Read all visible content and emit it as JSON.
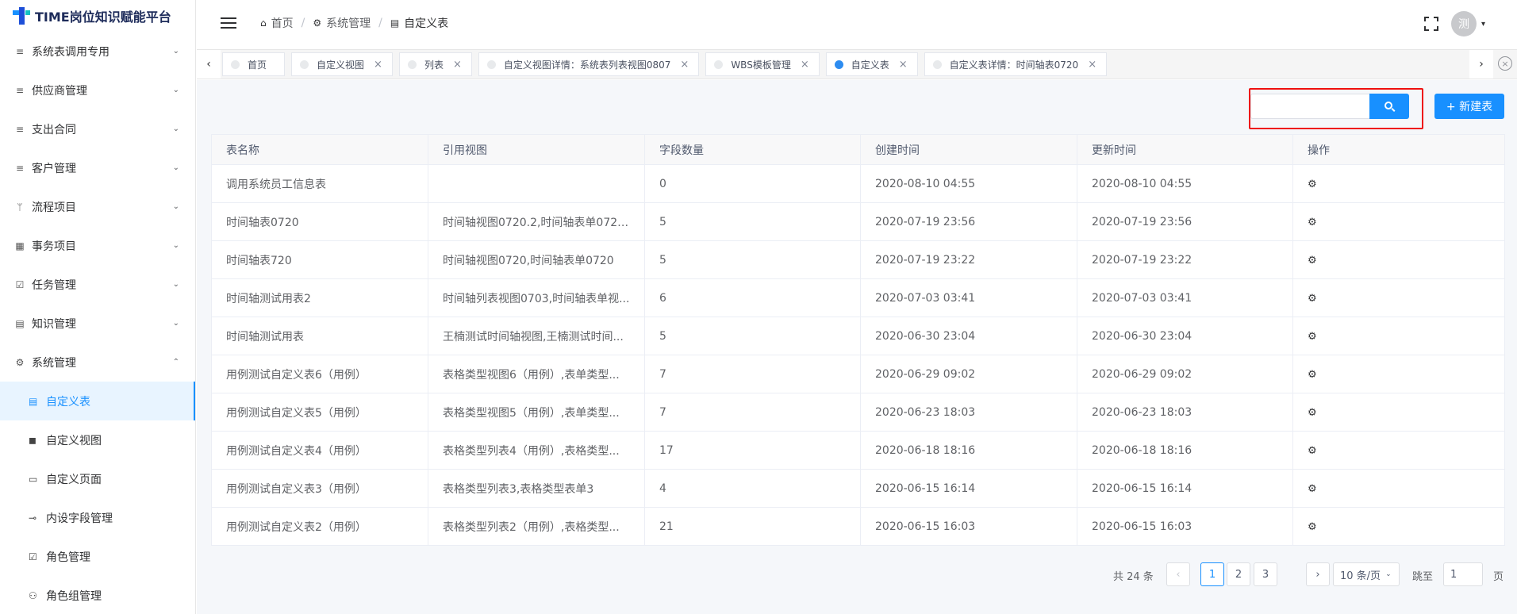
{
  "app": {
    "title": "TIME岗位知识赋能平台"
  },
  "sidebar": {
    "items": [
      {
        "label": "系统表调用专用",
        "icon": "list-icon",
        "glyph": "≡",
        "arrow": "⌄"
      },
      {
        "label": "供应商管理",
        "icon": "list-icon",
        "glyph": "≡",
        "arrow": "⌄"
      },
      {
        "label": "支出合同",
        "icon": "list-icon",
        "glyph": "≡",
        "arrow": "⌄"
      },
      {
        "label": "客户管理",
        "icon": "list-icon",
        "glyph": "≡",
        "arrow": "⌄"
      },
      {
        "label": "流程项目",
        "icon": "branch-icon",
        "glyph": "ᛘ",
        "arrow": "⌄"
      },
      {
        "label": "事务项目",
        "icon": "grid-icon",
        "glyph": "▦",
        "arrow": "⌄"
      },
      {
        "label": "任务管理",
        "icon": "calendar-check-icon",
        "glyph": "☑",
        "arrow": "⌄"
      },
      {
        "label": "知识管理",
        "icon": "book-icon",
        "glyph": "▤",
        "arrow": "⌄"
      },
      {
        "label": "系统管理",
        "icon": "gear-icon",
        "glyph": "⚙",
        "arrow": "⌃"
      }
    ],
    "subitems": [
      {
        "label": "自定义表",
        "icon": "document-icon",
        "glyph": "▤",
        "active": true
      },
      {
        "label": "自定义视图",
        "icon": "copy-icon",
        "glyph": "◼",
        "active": false
      },
      {
        "label": "自定义页面",
        "icon": "window-icon",
        "glyph": "▭",
        "active": false
      },
      {
        "label": "内设字段管理",
        "icon": "link-icon",
        "glyph": "⊸",
        "active": false
      },
      {
        "label": "角色管理",
        "icon": "checkbox-icon",
        "glyph": "☑",
        "active": false
      },
      {
        "label": "角色组管理",
        "icon": "people-icon",
        "glyph": "⚇",
        "active": false
      }
    ]
  },
  "header": {
    "breadcrumb": [
      {
        "label": "首页",
        "icon": "home-icon",
        "glyph": "⌂"
      },
      {
        "label": "系统管理",
        "icon": "gear-icon",
        "glyph": "⚙"
      },
      {
        "label": "自定义表",
        "icon": "document-icon",
        "glyph": "▤"
      }
    ],
    "separator": "/",
    "avatar_text": "测",
    "caret": "▾"
  },
  "tags": {
    "items": [
      {
        "label": "首页",
        "active": false,
        "closable": false
      },
      {
        "label": "自定义视图",
        "active": false,
        "closable": true
      },
      {
        "label": "列表",
        "active": false,
        "closable": true
      },
      {
        "label": "自定义视图详情：系统表列表视图0807",
        "active": false,
        "closable": true
      },
      {
        "label": "WBS模板管理",
        "active": false,
        "closable": true
      },
      {
        "label": "自定义表",
        "active": true,
        "closable": true
      },
      {
        "label": "自定义表详情：时间轴表0720",
        "active": false,
        "closable": true
      }
    ],
    "close_glyph": "×",
    "left_glyph": "‹",
    "right_glyph": "›",
    "close_all_glyph": "×"
  },
  "toolbar": {
    "search_value": "",
    "search_placeholder": "",
    "new_button": "+ 新建表"
  },
  "table": {
    "columns": [
      "表名称",
      "引用视图",
      "字段数量",
      "创建时间",
      "更新时间",
      "操作"
    ],
    "action_glyph": "⚙",
    "rows": [
      {
        "name": "调用系统员工信息表",
        "views": "",
        "count": "0",
        "created": "2020-08-10 04:55",
        "updated": "2020-08-10 04:55"
      },
      {
        "name": "时间轴表0720",
        "views": "时间轴视图0720.2,时间轴表单0720...",
        "count": "5",
        "created": "2020-07-19 23:56",
        "updated": "2020-07-19 23:56"
      },
      {
        "name": "时间轴表720",
        "views": "时间轴视图0720,时间轴表单0720",
        "count": "5",
        "created": "2020-07-19 23:22",
        "updated": "2020-07-19 23:22"
      },
      {
        "name": "时间轴测试用表2",
        "views": "时间轴列表视图0703,时间轴表单视...",
        "count": "6",
        "created": "2020-07-03 03:41",
        "updated": "2020-07-03 03:41"
      },
      {
        "name": "时间轴测试用表",
        "views": "王楠测试时间轴视图,王楠测试时间...",
        "count": "5",
        "created": "2020-06-30 23:04",
        "updated": "2020-06-30 23:04"
      },
      {
        "name": "用例测试自定义表6（用例）",
        "views": "表格类型视图6（用例）,表单类型...",
        "count": "7",
        "created": "2020-06-29 09:02",
        "updated": "2020-06-29 09:02"
      },
      {
        "name": "用例测试自定义表5（用例）",
        "views": "表格类型视图5（用例）,表单类型...",
        "count": "7",
        "created": "2020-06-23 18:03",
        "updated": "2020-06-23 18:03"
      },
      {
        "name": "用例测试自定义表4（用例）",
        "views": "表格类型列表4（用例）,表格类型...",
        "count": "17",
        "created": "2020-06-18 18:16",
        "updated": "2020-06-18 18:16"
      },
      {
        "name": "用例测试自定义表3（用例）",
        "views": "表格类型列表3,表格类型表单3",
        "count": "4",
        "created": "2020-06-15 16:14",
        "updated": "2020-06-15 16:14"
      },
      {
        "name": "用例测试自定义表2（用例）",
        "views": "表格类型列表2（用例）,表格类型...",
        "count": "21",
        "created": "2020-06-15 16:03",
        "updated": "2020-06-15 16:03"
      }
    ]
  },
  "pagination": {
    "total_text": "共 24 条",
    "prev": "‹",
    "next": "›",
    "pages": [
      "1",
      "2",
      "3"
    ],
    "current": "1",
    "page_size": "10 条/页",
    "size_caret": "⌄",
    "jump_label": "跳至",
    "jump_value": "1",
    "page_label": "页"
  },
  "colors": {
    "accent": "#1890ff",
    "highlight": "#ee1111"
  }
}
